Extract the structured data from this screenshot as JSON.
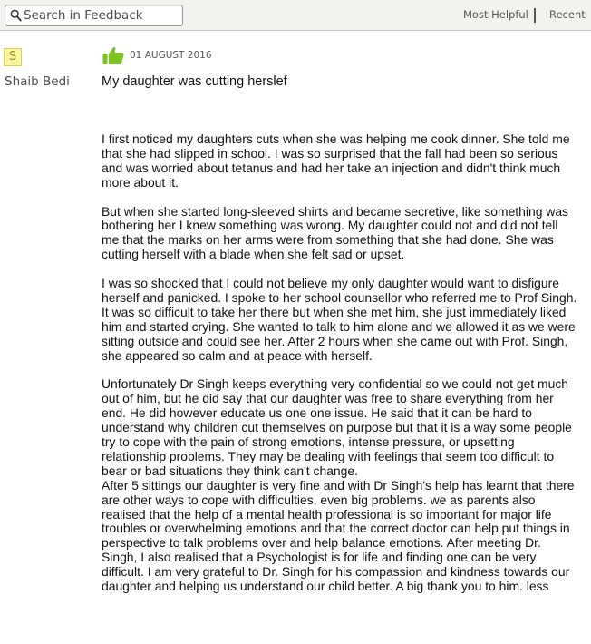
{
  "search": {
    "placeholder": "Search in Feedback",
    "icon": "search-icon"
  },
  "sort": {
    "most_helpful": "Most Helpful",
    "recent": "Recent"
  },
  "review": {
    "avatar_letter": "S",
    "author": "Shaib Bedi",
    "helpful_icon": "thumbs-up-icon",
    "accent_color": "#7dc423",
    "date": "01 AUGUST 2016",
    "title": "My daughter was cutting herslef",
    "paragraphs": [
      "I first noticed my daughters cuts when she was helping me cook dinner. She told me\nthat she had slipped in school. I was so surprised that the fall had been so serious\nand was worried about tetanus and had her take an injection and didn't think much\nmore about it.",
      "But when she started long-sleeved shirts and became secretive, like something was\nbothering her I knew something was wrong. My daughter could not and did not tell\nme that the marks on her arms were from something that she had done. She was\ncutting herself with a blade when she felt sad or upset.",
      "I was so shocked that I could not believe my only daughter would want to disfigure\nherself and panicked. I spoke to her school counsellor who referred me to Prof Singh.\nIt was so difficult to take her there but when she met him, she just immediately liked\nhim and started crying. She wanted to talk to him alone and we allowed it as we were\nsitting outside and could see her. After 2 hours when she came out with Prof. Singh,\nshe appeared so calm and at peace with herself.",
      "Unfortunately Dr Singh keeps everything very confidential so we could not get much\nout of him, but he did say that our daughter was free to share everything from her\nend. He did however educate us one one issue. He said that it can be hard to\nunderstand why children cut themselves on purpose but that it is a way some people\ntry to cope with the pain of strong emotions, intense pressure, or upsetting\nrelationship problems. They may be dealing with feelings that seem too difficult to\nbear or bad situations they think can't change.",
      "After 5 sittings our daughter is very fine and with Dr Singh's help has learnt that there\nare other ways to cope with difficulties, even big problems. we as parents also\nrealised that the help of a mental health professional is so important for major life\ntroubles or overwhelming emotions and that the correct doctor can help put things in\nperspective to talk problems over and help balance emotions. After meeting Dr.\nSingh, I also realised that a Psychologist is for life and finding one can be very\ndifficult. I am very grateful to Dr. Singh for his compassion and kindness towards our\ndaughter and helping us understand our child better. A big thank you to him. less"
    ]
  }
}
